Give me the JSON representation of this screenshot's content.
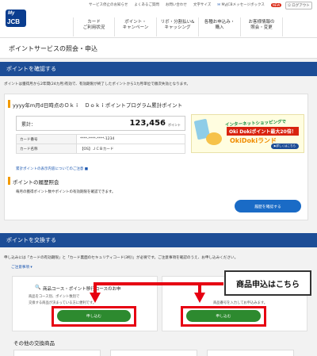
{
  "header": {
    "logo_top": "My",
    "logo_bottom": "JCB",
    "util_links": [
      "サービス停止のお知らせ",
      "よくあるご質問",
      "お問い合わせ",
      "文字サイズ"
    ],
    "messagebox_label": "MyJCBメッセージボックス",
    "new_badge": "NEW",
    "logout_label": "ログアウト",
    "nav": [
      {
        "line1": "カード",
        "line2": "ご利用状況"
      },
      {
        "line1": "ポイント・",
        "line2": "キャンペーン"
      },
      {
        "line1": "リボ・分割払い&",
        "line2": "キャッシング"
      },
      {
        "line1": "各種お申込み・",
        "line2": "購入"
      },
      {
        "line1": "お客様情報の",
        "line2": "照会・変更"
      }
    ]
  },
  "page_title": "ポイントサービスの照会・申込",
  "confirm": {
    "heading": "ポイントを確認する",
    "description": "ポイントは獲得月から2年間(24カ月)有効で、有効期限が終了したポイントから1カ月単位で順次失効となります。",
    "program_title": "yyyy年m月d日時点のＯｋｉ　Ｄｏｋｉポイントプログラム累計ポイント",
    "total_label": "累計：",
    "total_value": "123,456",
    "total_unit": "ポイント",
    "rows": [
      {
        "label": "カード番号",
        "value": "****-****-****-1234"
      },
      {
        "label": "カード名称",
        "value": "【OS】ＪＣＢカード"
      }
    ],
    "notes_link": "累計ポイントの表示内容についてのご注意 ■"
  },
  "banner": {
    "line1": "インターネットショッピングで",
    "line2": "Oki Dokiポイント最大20倍！",
    "line3": "OkiDokiランド",
    "button": "▶詳しくはこちら"
  },
  "history": {
    "heading": "ポイントの履歴照会",
    "description": "毎月の獲得ポイント数やポイントの有効期限を確認できます。",
    "button": "履歴を確認する"
  },
  "exchange": {
    "heading": "ポイントを交換する",
    "description": "申し込みには「カードの有効期限」と「カード裏面のセキュリティコード(3桁)」が必要です。ご注意事項を確認のうえ、お申し込みください。",
    "notes_link": "ご注意事項 ▾",
    "left_title": "商品コース・ポイント移行コースのお申",
    "left_line1": "商品をコース別、ポイント数別で",
    "left_line2": "交換する商品が決まっている方に便利です。",
    "right_line": "商品番号を入力してお申込みます。",
    "left_button": "申し込む",
    "right_button": "申し込む",
    "callout": "商品申込はこちら",
    "other_heading": "その他の交換商品"
  },
  "colors": {
    "nav_blue": "#1d4d96",
    "primary_button": "#1a6bc6",
    "apply_button": "#2d8a2f",
    "highlight_red": "#e60012"
  }
}
